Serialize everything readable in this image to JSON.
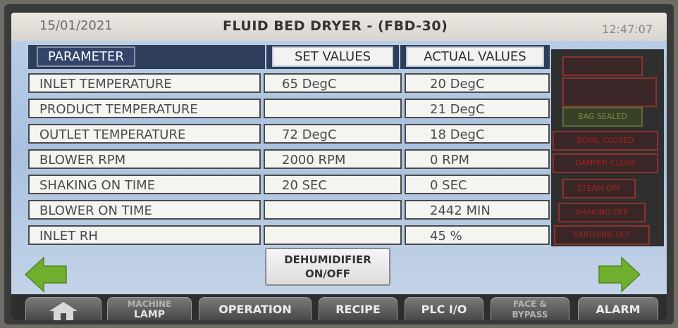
{
  "header": {
    "date": "15/01/2021",
    "title": "FLUID BED DRYER - (FBD-30)",
    "time": "12:47:07"
  },
  "columns": {
    "parameter": "PARAMETER",
    "set": "SET VALUES",
    "actual": "ACTUAL VALUES"
  },
  "rows": [
    {
      "name": "INLET TEMPERATURE",
      "set": "65 DegC",
      "actual": "20 DegC"
    },
    {
      "name": "PRODUCT TEMPERATURE",
      "set": "",
      "actual": "21 DegC"
    },
    {
      "name": "OUTLET TEMPERATURE",
      "set": "72 DegC",
      "actual": "18 DegC"
    },
    {
      "name": "BLOWER RPM",
      "set": "2000 RPM",
      "actual": "0 RPM"
    },
    {
      "name": "SHAKING ON TIME",
      "set": "20 SEC",
      "actual": "0 SEC"
    },
    {
      "name": "BLOWER ON TIME",
      "set": "",
      "actual": "2442 MIN"
    },
    {
      "name": "INLET RH",
      "set": "",
      "actual": "45 %"
    }
  ],
  "status_indicators": [
    {
      "label": "",
      "color": "#8a3330"
    },
    {
      "label": "",
      "color": "#8a3330"
    },
    {
      "label": "BAG SEALED",
      "color": "#7a8a44"
    },
    {
      "label": "BOWL CLOSED",
      "color": "#a02222"
    },
    {
      "label": "DAMPER CLOSE",
      "color": "#a02222"
    },
    {
      "label": "STEAM OFF",
      "color": "#a02222"
    },
    {
      "label": "SHAKING OFF",
      "color": "#a02222"
    },
    {
      "label": "EARTHING OFF",
      "color": "#a02222"
    }
  ],
  "dehumidifier": {
    "line1": "DEHUMIDIFIER",
    "line2": "ON/OFF"
  },
  "nav": {
    "home_icon": "home-icon",
    "machine_lamp_1": "MACHINE",
    "machine_lamp_2": "LAMP",
    "operation": "OPERATION",
    "recipe": "RECIPE",
    "plc_io": "PLC I/O",
    "face_bypass_1": "FACE &",
    "face_bypass_2": "BYPASS",
    "alarm": "ALARM"
  },
  "colors": {
    "header_bar": "#2d3d5a",
    "arrow": "#6fae2e",
    "screen_bg": "#a9c1df"
  }
}
